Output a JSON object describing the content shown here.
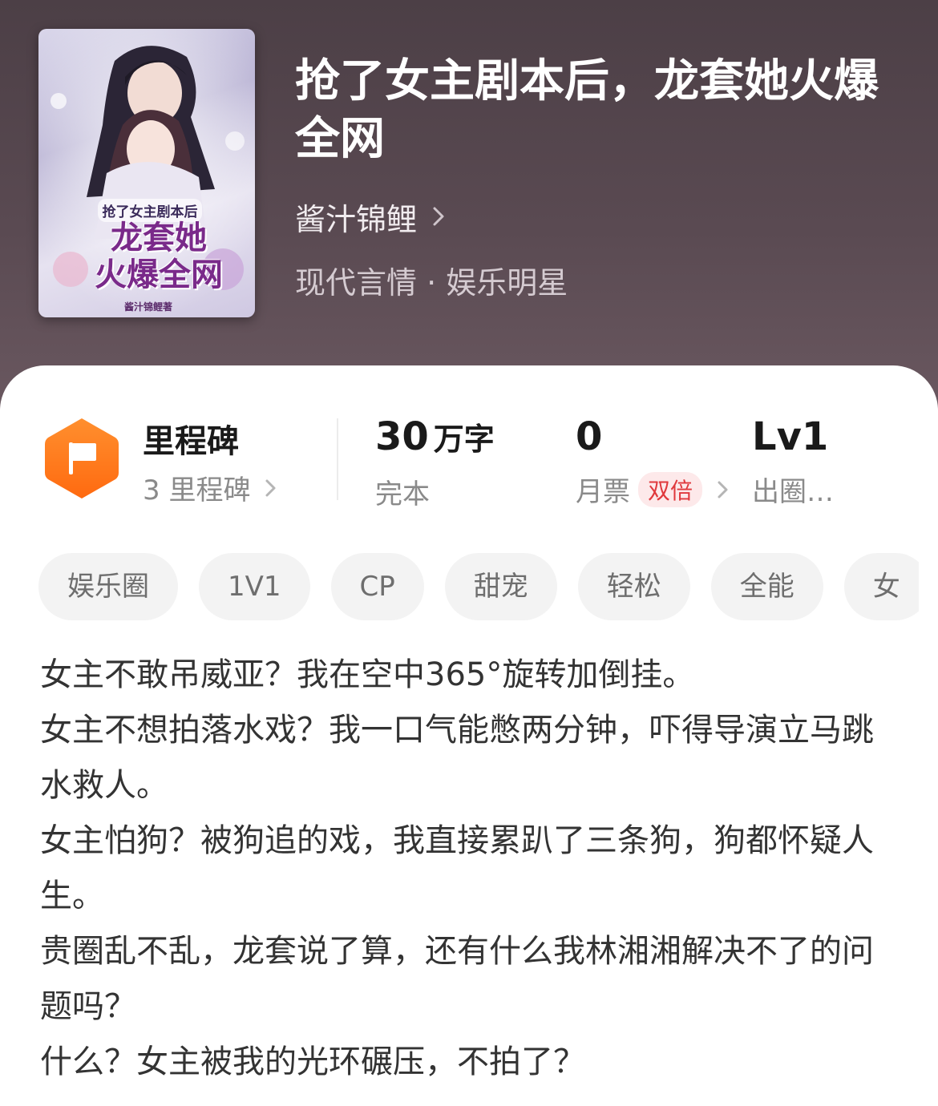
{
  "book": {
    "title": "抢了女主剧本后，龙套她火爆全网",
    "author": "酱汁锦鲤",
    "genre": "现代言情 · 娱乐明星",
    "cover": {
      "small_text": "抢了女主剧本后",
      "big_text_line1": "龙套她",
      "big_text_line2": "火爆全网",
      "author_text": "酱汁锦鲤著"
    }
  },
  "stats": {
    "milestone": {
      "title": "里程碑",
      "sub": "3 里程碑"
    },
    "words": {
      "value": "30",
      "unit": "万字",
      "label": "完本"
    },
    "monthly_ticket": {
      "value": "0",
      "label": "月票",
      "badge": "双倍"
    },
    "level": {
      "value": "Lv1",
      "label": "出圈…"
    }
  },
  "tags": [
    "娱乐圈",
    "1V1",
    "CP",
    "甜宠",
    "轻松",
    "全能",
    "女"
  ],
  "synopsis": [
    "女主不敢吊威亚？我在空中365°旋转加倒挂。",
    "女主不想拍落水戏？我一口气能憋两分钟，吓得导演立马跳水救人。",
    "女主怕狗？被狗追的戏，我直接累趴了三条狗，狗都怀疑人生。",
    "贵圈乱不乱，龙套说了算，还有什么我林湘湘解决不了的问题吗？",
    "什么？女主被我的光环碾压，不拍了？"
  ],
  "colors": {
    "header_bg": "#4c3f46",
    "accent_orange": "#ff7a1a",
    "badge_red": "#e0393d"
  }
}
